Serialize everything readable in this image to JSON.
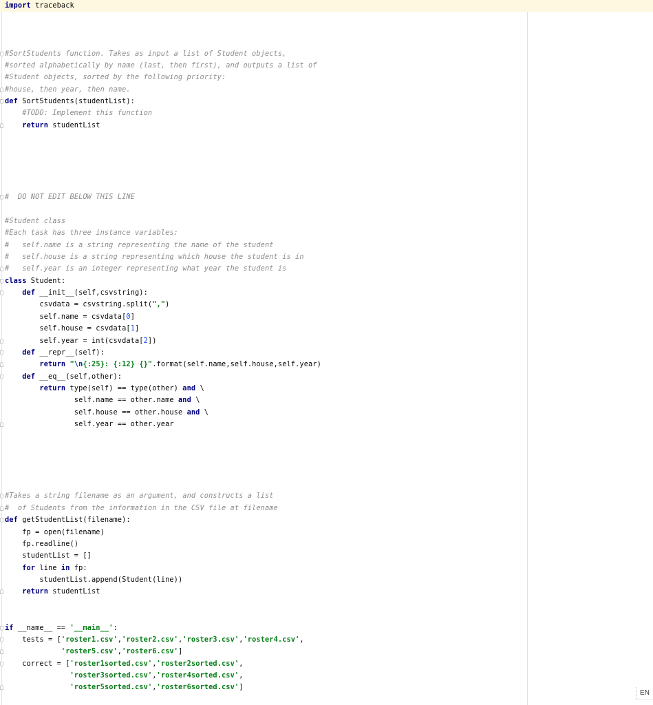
{
  "editor": {
    "language": "python",
    "current_line": 1,
    "lines": [
      {
        "n": 1,
        "tokens": [
          [
            "kw",
            "import"
          ],
          [
            "",
            ""
          ],
          [
            "",
            " traceback"
          ]
        ]
      },
      {
        "n": 2,
        "tokens": []
      },
      {
        "n": 3,
        "tokens": []
      },
      {
        "n": 4,
        "tokens": []
      },
      {
        "n": 5,
        "fold": "down",
        "tokens": [
          [
            "cm",
            "#SortStudents function. Takes as input a list of Student objects,"
          ]
        ]
      },
      {
        "n": 6,
        "tokens": [
          [
            "cm",
            "#sorted alphabetically by name (last, then first), and outputs a list of"
          ]
        ]
      },
      {
        "n": 7,
        "tokens": [
          [
            "cm",
            "#Student objects, sorted by the following priority:"
          ]
        ]
      },
      {
        "n": 8,
        "fold": "up",
        "tokens": [
          [
            "cm",
            "#house, then year, then name."
          ]
        ]
      },
      {
        "n": 9,
        "fold": "down",
        "tokens": [
          [
            "kw",
            "def"
          ],
          [
            "",
            " SortStudents(studentList):"
          ]
        ]
      },
      {
        "n": 10,
        "tokens": [
          [
            "",
            "    "
          ],
          [
            "cm",
            "#TODO: Implement this function"
          ]
        ]
      },
      {
        "n": 11,
        "fold": "up",
        "tokens": [
          [
            "",
            "    "
          ],
          [
            "kw",
            "return"
          ],
          [
            "",
            " studentList"
          ]
        ]
      },
      {
        "n": 12,
        "tokens": []
      },
      {
        "n": 13,
        "tokens": []
      },
      {
        "n": 14,
        "tokens": []
      },
      {
        "n": 15,
        "tokens": []
      },
      {
        "n": 16,
        "tokens": []
      },
      {
        "n": 17,
        "fold": "down",
        "tokens": [
          [
            "cm",
            "#  DO NOT EDIT BELOW THIS LINE"
          ]
        ]
      },
      {
        "n": 18,
        "tokens": []
      },
      {
        "n": 19,
        "tokens": [
          [
            "cm",
            "#Student class"
          ]
        ]
      },
      {
        "n": 20,
        "tokens": [
          [
            "cm",
            "#Each task has three instance variables:"
          ]
        ]
      },
      {
        "n": 21,
        "tokens": [
          [
            "cm",
            "#   self.name is a string representing the name of the student"
          ]
        ]
      },
      {
        "n": 22,
        "tokens": [
          [
            "cm",
            "#   self.house is a string representing which house the student is in"
          ]
        ]
      },
      {
        "n": 23,
        "fold": "up",
        "tokens": [
          [
            "cm",
            "#   self.year is an integer representing what year the student is"
          ]
        ]
      },
      {
        "n": 24,
        "fold": "down",
        "tokens": [
          [
            "kw",
            "class"
          ],
          [
            "",
            " Student:"
          ]
        ]
      },
      {
        "n": 25,
        "fold": "down",
        "tokens": [
          [
            "",
            "    "
          ],
          [
            "kw",
            "def"
          ],
          [
            "",
            " __init__(self,csvstring):"
          ]
        ]
      },
      {
        "n": 26,
        "tokens": [
          [
            "",
            "        csvdata = csvstring.split("
          ],
          [
            "st",
            "\",\""
          ],
          [
            "",
            ")"
          ]
        ]
      },
      {
        "n": 27,
        "tokens": [
          [
            "",
            "        self.name = csvdata["
          ],
          [
            "num",
            "0"
          ],
          [
            "",
            "]"
          ]
        ]
      },
      {
        "n": 28,
        "tokens": [
          [
            "",
            "        self.house = csvdata["
          ],
          [
            "num",
            "1"
          ],
          [
            "",
            "]"
          ]
        ]
      },
      {
        "n": 29,
        "fold": "up",
        "tokens": [
          [
            "",
            "        self.year = int(csvdata["
          ],
          [
            "num",
            "2"
          ],
          [
            "",
            "])"
          ]
        ]
      },
      {
        "n": 30,
        "fold": "down",
        "tokens": [
          [
            "",
            "    "
          ],
          [
            "kw",
            "def"
          ],
          [
            "",
            " __repr__(self):"
          ]
        ]
      },
      {
        "n": 31,
        "fold": "up",
        "tokens": [
          [
            "",
            "        "
          ],
          [
            "kw",
            "return"
          ],
          [
            "",
            " "
          ],
          [
            "st",
            "\""
          ],
          [
            "esc",
            "\\n"
          ],
          [
            "st",
            "{:25}: {:12} {}\""
          ],
          [
            "",
            ".format(self.name,self.house,self.year)"
          ]
        ]
      },
      {
        "n": 32,
        "fold": "down",
        "tokens": [
          [
            "",
            "    "
          ],
          [
            "kw",
            "def"
          ],
          [
            "",
            " __eq__(self,other):"
          ]
        ]
      },
      {
        "n": 33,
        "tokens": [
          [
            "",
            "        "
          ],
          [
            "kw",
            "return"
          ],
          [
            "",
            " type(self) == type(other) "
          ],
          [
            "kw",
            "and"
          ],
          [
            "",
            " \\"
          ]
        ]
      },
      {
        "n": 34,
        "tokens": [
          [
            "",
            "                self.name == other.name "
          ],
          [
            "kw",
            "and"
          ],
          [
            "",
            " \\"
          ]
        ]
      },
      {
        "n": 35,
        "tokens": [
          [
            "",
            "                self.house == other.house "
          ],
          [
            "kw",
            "and"
          ],
          [
            "",
            " \\"
          ]
        ]
      },
      {
        "n": 36,
        "fold": "up",
        "tokens": [
          [
            "",
            "                self.year == other.year"
          ]
        ]
      },
      {
        "n": 37,
        "tokens": []
      },
      {
        "n": 38,
        "tokens": []
      },
      {
        "n": 39,
        "tokens": []
      },
      {
        "n": 40,
        "tokens": []
      },
      {
        "n": 41,
        "tokens": []
      },
      {
        "n": 42,
        "fold": "down",
        "tokens": [
          [
            "cm",
            "#Takes a string filename as an argument, and constructs a list"
          ]
        ]
      },
      {
        "n": 43,
        "fold": "up",
        "tokens": [
          [
            "cm",
            "#  of Students from the information in the CSV file at filename"
          ]
        ]
      },
      {
        "n": 44,
        "fold": "down",
        "tokens": [
          [
            "kw",
            "def"
          ],
          [
            "",
            " getStudentList(filename):"
          ]
        ]
      },
      {
        "n": 45,
        "tokens": [
          [
            "",
            "    fp = open(filename)"
          ]
        ]
      },
      {
        "n": 46,
        "tokens": [
          [
            "",
            "    fp.readline()"
          ]
        ]
      },
      {
        "n": 47,
        "tokens": [
          [
            "",
            "    studentList = []"
          ]
        ]
      },
      {
        "n": 48,
        "tokens": [
          [
            "",
            "    "
          ],
          [
            "kw",
            "for"
          ],
          [
            "",
            " line "
          ],
          [
            "kw",
            "in"
          ],
          [
            "",
            " fp:"
          ]
        ]
      },
      {
        "n": 49,
        "tokens": [
          [
            "",
            "        studentList.append(Student(line))"
          ]
        ]
      },
      {
        "n": 50,
        "fold": "up",
        "tokens": [
          [
            "",
            "    "
          ],
          [
            "kw",
            "return"
          ],
          [
            "",
            " studentList"
          ]
        ]
      },
      {
        "n": 51,
        "tokens": []
      },
      {
        "n": 52,
        "tokens": []
      },
      {
        "n": 53,
        "fold": "down",
        "tokens": [
          [
            "kw",
            "if"
          ],
          [
            "",
            " __name__ == "
          ],
          [
            "st",
            "'__main__'"
          ],
          [
            "",
            ":"
          ]
        ]
      },
      {
        "n": 54,
        "fold": "down",
        "tokens": [
          [
            "",
            "    tests = ["
          ],
          [
            "st",
            "'roster1.csv'"
          ],
          [
            "",
            ","
          ],
          [
            "st",
            "'roster2.csv'"
          ],
          [
            "",
            ","
          ],
          [
            "st",
            "'roster3.csv'"
          ],
          [
            "",
            ","
          ],
          [
            "st",
            "'roster4.csv'"
          ],
          [
            "",
            ","
          ]
        ]
      },
      {
        "n": 55,
        "fold": "up",
        "tokens": [
          [
            "",
            "             "
          ],
          [
            "st",
            "'roster5.csv'"
          ],
          [
            "",
            ","
          ],
          [
            "st",
            "'roster6.csv'"
          ],
          [
            "",
            "]"
          ]
        ]
      },
      {
        "n": 56,
        "fold": "down",
        "tokens": [
          [
            "",
            "    correct = ["
          ],
          [
            "st",
            "'roster1sorted.csv'"
          ],
          [
            "",
            ","
          ],
          [
            "st",
            "'roster2sorted.csv'"
          ],
          [
            "",
            ","
          ]
        ]
      },
      {
        "n": 57,
        "tokens": [
          [
            "",
            "               "
          ],
          [
            "st",
            "'roster3sorted.csv'"
          ],
          [
            "",
            ","
          ],
          [
            "st",
            "'roster4sorted.csv'"
          ],
          [
            "",
            ","
          ]
        ]
      },
      {
        "n": 58,
        "fold": "up",
        "tokens": [
          [
            "",
            "               "
          ],
          [
            "st",
            "'roster5sorted.csv'"
          ],
          [
            "",
            ","
          ],
          [
            "st",
            "'roster6sorted.csv'"
          ],
          [
            "",
            "]"
          ]
        ]
      }
    ]
  },
  "status": {
    "input_language": "EN"
  }
}
